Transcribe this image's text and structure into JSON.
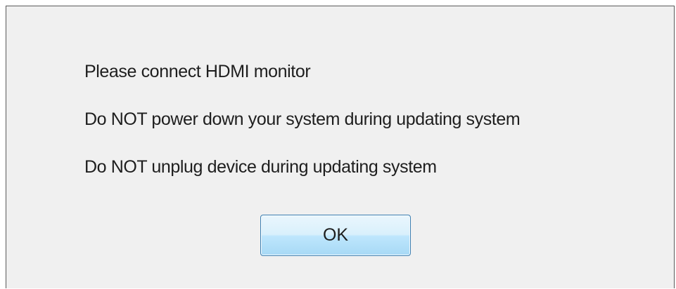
{
  "dialog": {
    "messages": [
      "Please connect HDMI monitor",
      "Do NOT power down your system during updating system",
      "Do NOT unplug device during updating system"
    ],
    "ok_label": "OK"
  },
  "colors": {
    "dialog_background": "#f0f0f0",
    "button_border": "#3c7fb1",
    "button_face": "#bee6fd"
  }
}
